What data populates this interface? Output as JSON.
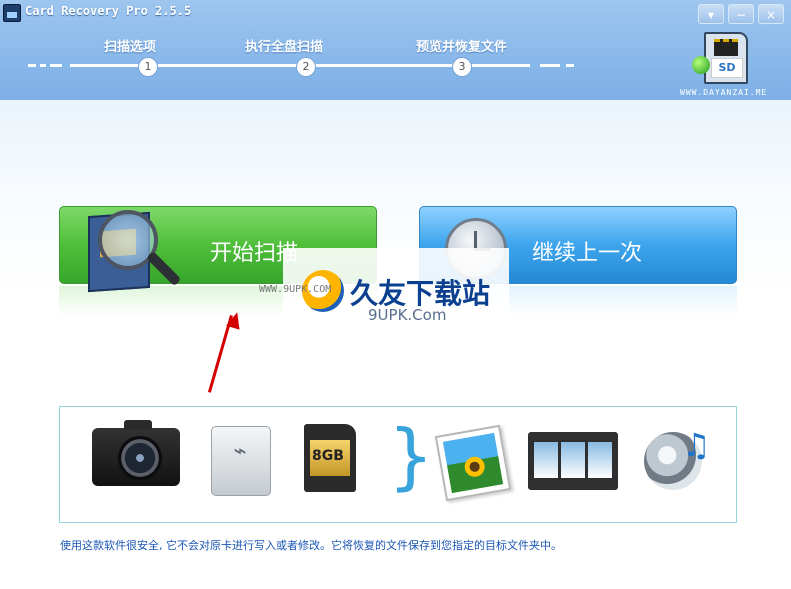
{
  "window": {
    "title": "Card Recovery Pro 2.5.5",
    "controls": {
      "dropdown": "▾",
      "minimize": "−",
      "close": "×"
    }
  },
  "steps": [
    {
      "num": "1",
      "label": "扫描选项"
    },
    {
      "num": "2",
      "label": "执行全盘扫描"
    },
    {
      "num": "3",
      "label": "预览并恢复文件"
    }
  ],
  "brand": {
    "card_label": "SD",
    "site": "WWW.DAYANZAI.ME"
  },
  "buttons": {
    "start_scan": "开始扫描",
    "continue_last": "继续上一次"
  },
  "watermark": {
    "small": "WWW.9UPK.COM",
    "title": "久友下载站",
    "url": "9UPK.Com"
  },
  "devices": {
    "sd_card_capacity": "8GB"
  },
  "footer": {
    "text": "使用这款软件很安全, 它不会对原卡进行写入或者修改。它将恢复的文件保存到您指定的目标文件夹中。"
  },
  "colors": {
    "header": "#89b8ea",
    "green_button": "#4fbf3a",
    "blue_button": "#3da5ec",
    "arrow": "#d40000",
    "footer_text": "#1a56b3"
  }
}
